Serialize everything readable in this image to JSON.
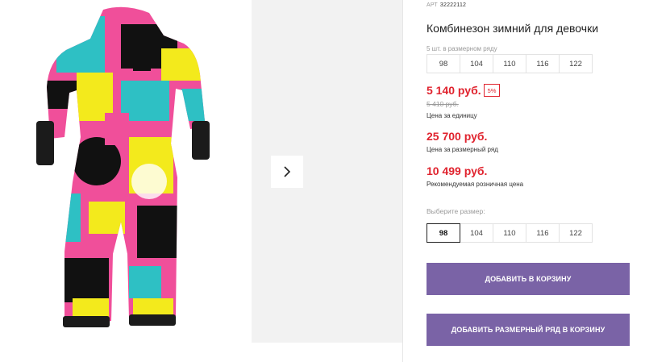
{
  "product": {
    "article_label": "АРТ",
    "article_number": "32222112",
    "title": "Комбинезон зимний для девочки",
    "image_alt": "Комбинезон зимний для девочки"
  },
  "size_row": {
    "caption": "5 шт. в размерном ряду",
    "sizes": [
      "98",
      "104",
      "110",
      "116",
      "122"
    ]
  },
  "pricing": {
    "unit_price": "5 140 руб.",
    "discount": "5%",
    "old_price": "5 410 руб.",
    "unit_price_note": "Цена за единицу",
    "row_price": "25 700 руб.",
    "row_price_note": "Цена за размерный ряд",
    "retail_price": "10 499 руб.",
    "retail_price_note": "Рекомендуемая розничная цена"
  },
  "size_select": {
    "label": "Выберите размер:",
    "options": [
      "98",
      "104",
      "110",
      "116",
      "122"
    ],
    "selected": "98"
  },
  "actions": {
    "add_to_cart": "ДОБАВИТЬ В КОРЗИНУ",
    "add_row_to_cart": "ДОБАВИТЬ РАЗМЕРНЫЙ РЯД В КОРЗИНУ"
  },
  "gallery": {
    "next_icon": "chevron-right-icon"
  },
  "colors": {
    "accent": "#7a63a6",
    "price_red": "#e0232e",
    "muted": "#999999"
  }
}
